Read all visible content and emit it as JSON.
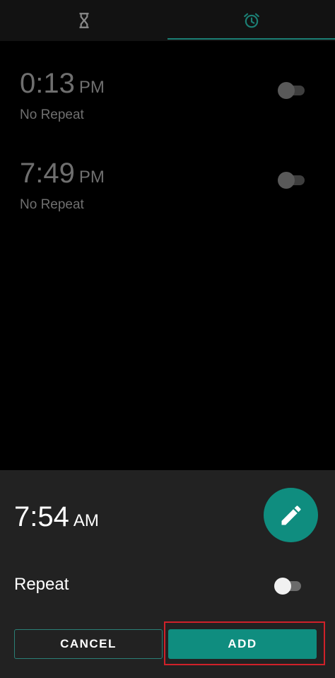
{
  "tabs": [
    {
      "icon": "hourglass-icon",
      "active": false
    },
    {
      "icon": "alarm-clock-icon",
      "active": true
    }
  ],
  "alarms": [
    {
      "time": "0:13",
      "ampm": "PM",
      "repeat": "No Repeat",
      "enabled": false
    },
    {
      "time": "7:49",
      "ampm": "PM",
      "repeat": "No Repeat",
      "enabled": false
    }
  ],
  "new_alarm": {
    "time": "7:54",
    "ampm": "AM",
    "repeat_label": "Repeat",
    "repeat_enabled": false,
    "edit_icon": "pencil-icon",
    "cancel_label": "CANCEL",
    "add_label": "ADD"
  },
  "colors": {
    "accent": "#0f8d7f",
    "highlight": "#d0212a",
    "background": "#000000",
    "sheet": "#222222"
  }
}
